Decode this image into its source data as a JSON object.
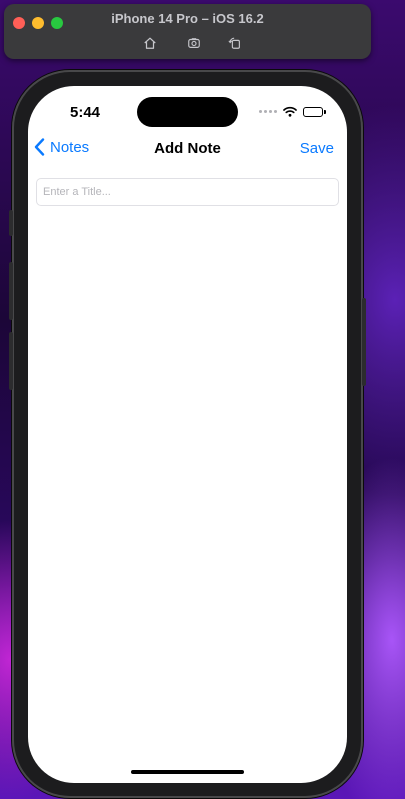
{
  "simulator": {
    "title": "iPhone 14 Pro – iOS 16.2",
    "tools": [
      "home-icon",
      "screenshot-icon",
      "rotate-icon"
    ]
  },
  "status_bar": {
    "time": "5:44",
    "icons": [
      "signal-dots-icon",
      "wifi-icon",
      "battery-icon"
    ]
  },
  "nav_bar": {
    "back_label": "Notes",
    "title": "Add Note",
    "save_label": "Save"
  },
  "form": {
    "title_value": "",
    "title_placeholder": "Enter a Title..."
  },
  "colors": {
    "accent": "#0a7aff"
  }
}
